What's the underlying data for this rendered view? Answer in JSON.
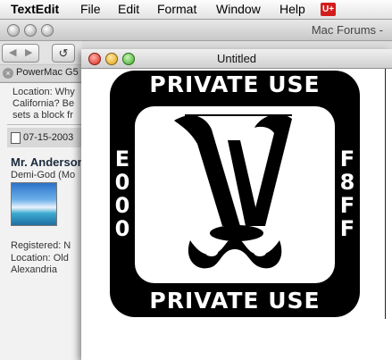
{
  "menubar": {
    "app_name": "TextEdit",
    "items": [
      "File",
      "Edit",
      "Format",
      "Window",
      "Help"
    ],
    "input_menu_label": "U+"
  },
  "browser": {
    "window_title": "Mac Forums -",
    "tab_label": "PowerMac G5",
    "post_location_text": "Location: Why",
    "post_line2": "California? Be",
    "post_line3": "sets a block fr",
    "post_date": "07-15-2003",
    "user_name": "Mr. Anderson",
    "user_title": "Demi-God (Mo",
    "registered": "Registered: N",
    "location": "Location: Old",
    "location2": "Alexandria"
  },
  "textedit": {
    "window_title": "Untitled",
    "glyph": {
      "top_text": "PRIVATE USE",
      "bottom_text": "PRIVATE USE",
      "left_code": "E000",
      "right_code": "F8FF",
      "monogram": "W"
    }
  },
  "colors": {
    "glyph_background": "#000000",
    "input_menu": "#d31d1d",
    "close_button": "#d7261b",
    "minimize_button": "#e0a012",
    "zoom_button": "#3aa827"
  }
}
